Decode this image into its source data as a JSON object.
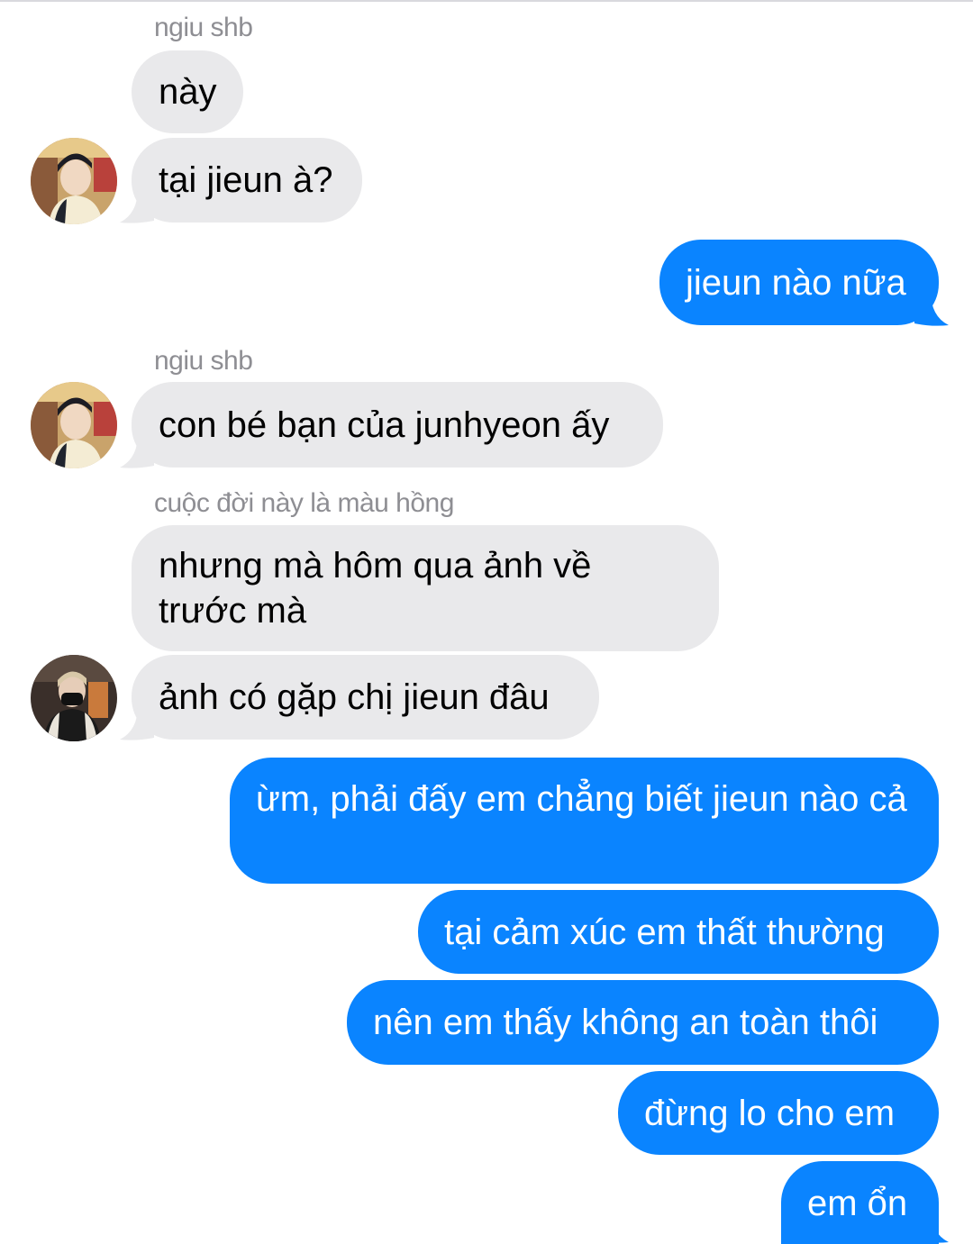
{
  "colors": {
    "incoming_bubble": "#e9e9eb",
    "outgoing_bubble": "#0a84ff",
    "sender_name": "#8e8e93"
  },
  "conversation": {
    "group1": {
      "sender": "ngiu shb",
      "messages": [
        "này",
        "tại jieun à?"
      ],
      "avatar_icon": "profile-photo-icon"
    },
    "reply1": "jieun nào nữa",
    "group2": {
      "sender": "ngiu shb",
      "messages": [
        "con bé bạn của junhyeon ấy"
      ],
      "avatar_icon": "profile-photo-icon"
    },
    "group3": {
      "sender": "cuộc đời này là màu hồng",
      "messages": [
        "nhưng mà hôm qua ảnh về trước mà",
        "ảnh có gặp chị jieun đâu"
      ],
      "avatar_icon": "profile-photo-icon"
    },
    "replies": [
      "ừm, phải đấy em chẳng biết jieun nào cả",
      "tại cảm xúc em thất thường",
      "nên em thấy không an toàn thôi",
      "đừng lo cho em",
      "em ổn"
    ]
  }
}
